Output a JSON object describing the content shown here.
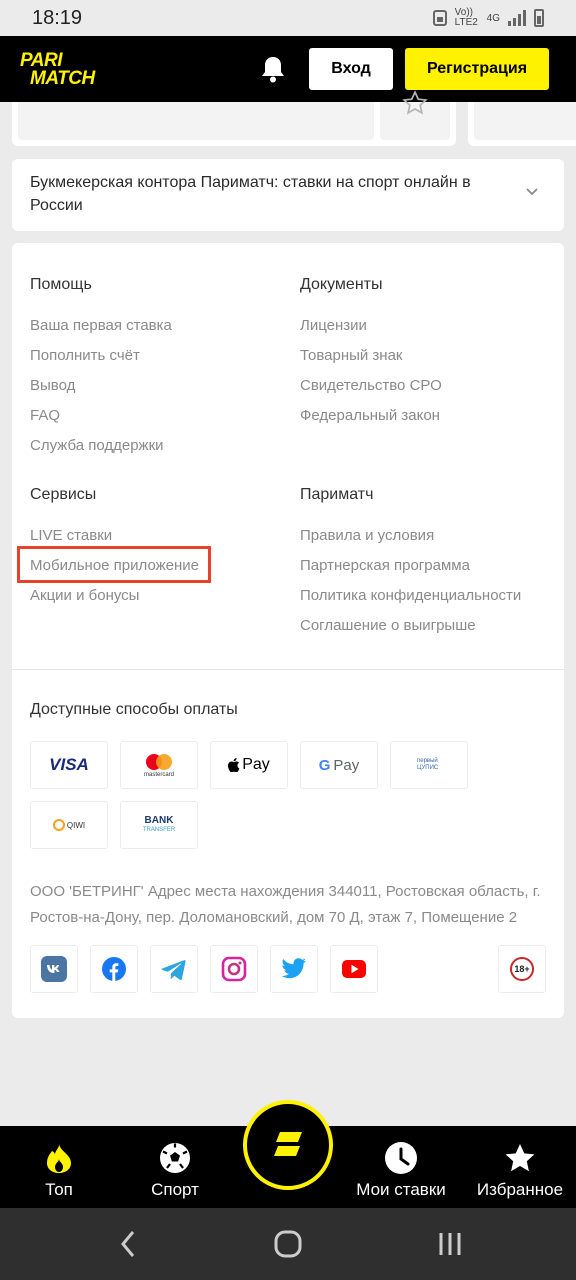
{
  "status_bar": {
    "time": "18:19",
    "network_1": "Vo)) LTE2",
    "network_2": "4G"
  },
  "header": {
    "logo_line1": "PARI",
    "logo_line2": "MATCH",
    "login_label": "Вход",
    "register_label": "Регистрация"
  },
  "seo": {
    "title": "Букмекерская контора Париматч: ставки на спорт онлайн в России"
  },
  "footer": {
    "help": {
      "title": "Помощь",
      "links": [
        "Ваша первая ставка",
        "Пополнить счёт",
        "Вывод",
        "FAQ",
        "Служба поддержки"
      ]
    },
    "documents": {
      "title": "Документы",
      "links": [
        "Лицензии",
        "Товарный знак",
        "Свидетельство СРО",
        "Федеральный закон"
      ]
    },
    "services": {
      "title": "Сервисы",
      "links": [
        "LIVE ставки",
        "Мобильное приложение",
        "Акции и бонусы"
      ]
    },
    "parimatch": {
      "title": "Париматч",
      "links": [
        "Правила и условия",
        "Партнерская программа",
        "Политика конфиденциальности",
        "Соглашение о выигрыше"
      ]
    },
    "payments": {
      "title": "Доступные способы оплаты",
      "visa": "VISA",
      "mastercard": "mastercard",
      "applepay": "Pay",
      "googlepay_g": "G",
      "googlepay": "Pay",
      "cupis_1": "первый",
      "cupis_2": "ЦУПИС",
      "qiwi": "QIWI",
      "bank_1": "BANK",
      "bank_2": "TRANSFER"
    },
    "address": "ООО 'БЕТРИНГ' Адрес места нахождения 344011, Ростовская область, г. Ростов-на-Дону, пер. Доломановский, дом 70 Д, этаж 7, Помещение 2",
    "age_badge": "18+"
  },
  "bottom_nav": {
    "top": "Топ",
    "sport": "Спорт",
    "my_bets": "Мои ставки",
    "favorites": "Избранное"
  },
  "colors": {
    "brand_yellow": "#fff200",
    "highlight_red": "#e8412c",
    "header_bg": "#000000"
  }
}
